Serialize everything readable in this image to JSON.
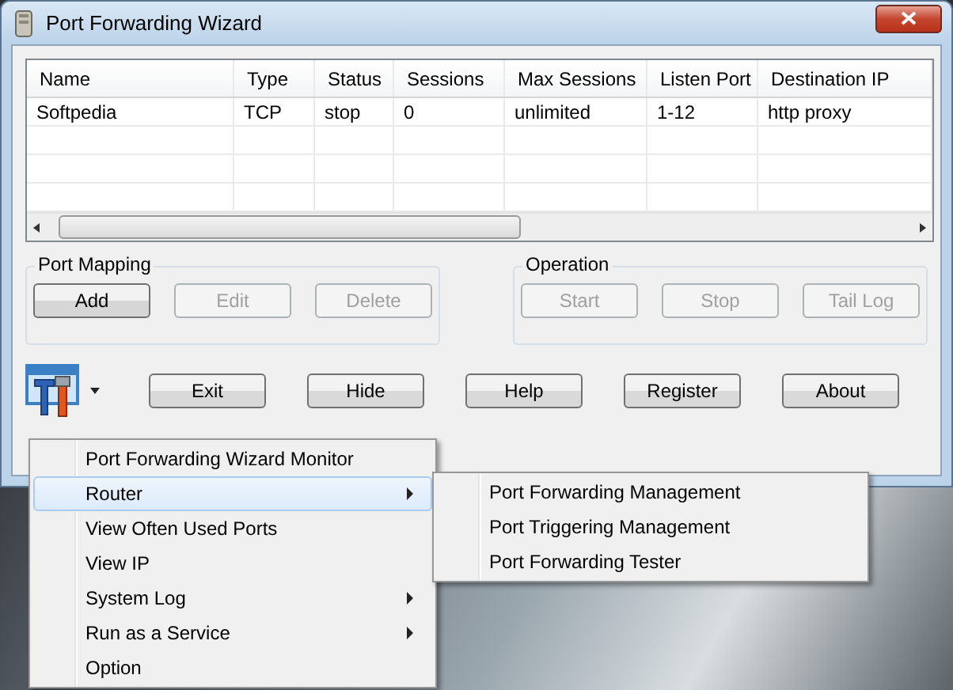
{
  "window": {
    "title": "Port Forwarding Wizard"
  },
  "table": {
    "columns": [
      "Name",
      "Type",
      "Status",
      "Sessions",
      "Max Sessions",
      "Listen Port",
      "Destination IP"
    ],
    "rows": [
      [
        "Softpedia",
        "TCP",
        "stop",
        "0",
        "unlimited",
        "1-12",
        "http proxy"
      ]
    ]
  },
  "groups": [
    {
      "title": "Port Mapping",
      "buttons": [
        {
          "label": "Add",
          "disabled": false
        },
        {
          "label": "Edit",
          "disabled": true
        },
        {
          "label": "Delete",
          "disabled": true
        }
      ]
    },
    {
      "title": "Operation",
      "buttons": [
        {
          "label": "Start",
          "disabled": true
        },
        {
          "label": "Stop",
          "disabled": true
        },
        {
          "label": "Tail Log",
          "disabled": true
        }
      ]
    }
  ],
  "bottom_buttons": [
    "Exit",
    "Hide",
    "Help",
    "Register",
    "About"
  ],
  "context_menu": {
    "items": [
      {
        "label": "Port Forwarding Wizard Monitor",
        "selected": false,
        "submenu": false
      },
      {
        "label": "Router",
        "selected": true,
        "submenu": true
      },
      {
        "label": "View Often Used Ports",
        "selected": false,
        "submenu": false
      },
      {
        "label": "View IP",
        "selected": false,
        "submenu": false
      },
      {
        "label": "System Log",
        "selected": false,
        "submenu": true
      },
      {
        "label": "Run as a Service",
        "selected": false,
        "submenu": true
      },
      {
        "label": "Option",
        "selected": false,
        "submenu": false
      }
    ]
  },
  "submenu": {
    "items": [
      "Port Forwarding Management",
      "Port Triggering Management",
      "Port Forwarding Tester"
    ]
  }
}
